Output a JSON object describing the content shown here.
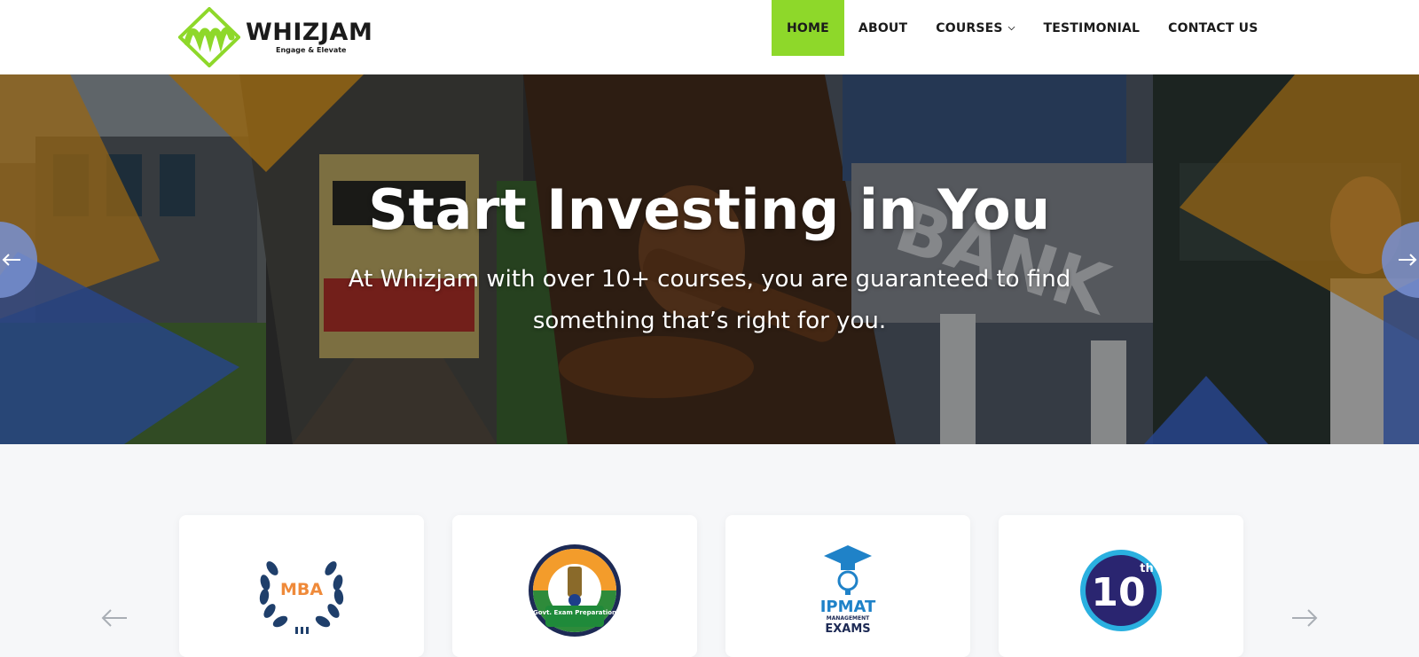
{
  "brand": {
    "name": "WHIZJAM",
    "tagline": "Engage & Elevate",
    "colors": {
      "green": "#8ed82a",
      "dark": "#1b1b1b",
      "blue": "#3f6fe0",
      "orange": "#f0a321"
    }
  },
  "nav": {
    "items": [
      {
        "label": "HOME",
        "active": true
      },
      {
        "label": "ABOUT"
      },
      {
        "label": "COURSES",
        "has_dropdown": true
      },
      {
        "label": "TESTIMONIAL"
      },
      {
        "label": "CONTACT US"
      }
    ]
  },
  "hero": {
    "title": "Start Investing in You",
    "subtitle": "At Whizjam with over 10+ courses, you are guaranteed to find something that’s right for you.",
    "prev_icon": "arrow-left-icon",
    "next_icon": "arrow-right-icon",
    "bank_sign": "BANK"
  },
  "courses": {
    "cards": [
      {
        "name": "mba",
        "logo_text": "MBA",
        "icon": "laurel-wreath-icon"
      },
      {
        "name": "govt-exam",
        "logo_text": "Govt. Exam Preparation",
        "icon": "emblem-badge-icon"
      },
      {
        "name": "ipmat",
        "logo_text": "IPMAT",
        "logo_small": "MANAGEMENT",
        "logo_sub": "EXAMS",
        "icon": "graduation-cap-icon"
      },
      {
        "name": "tenth",
        "logo_text": "10",
        "logo_sup": "th",
        "icon": "circle-badge-icon"
      }
    ],
    "prev_icon": "arrow-left-icon",
    "next_icon": "arrow-right-icon"
  }
}
